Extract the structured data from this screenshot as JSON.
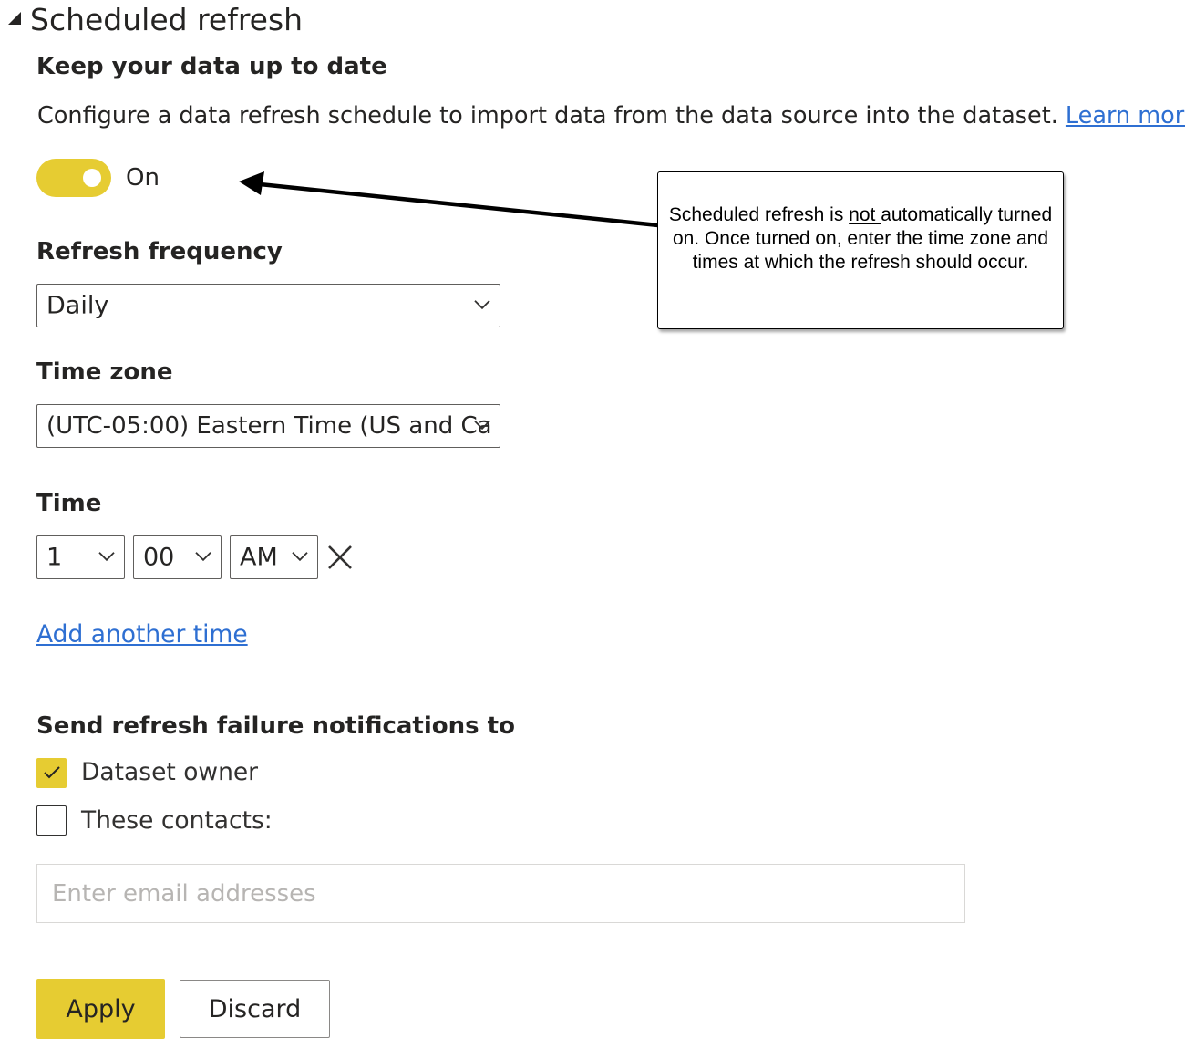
{
  "section": {
    "title": "Scheduled refresh"
  },
  "intro": {
    "heading": "Keep your data up to date",
    "description": "Configure a data refresh schedule to import data from the data source into the dataset.",
    "learn_more": "Learn more"
  },
  "toggle": {
    "state": "on",
    "label": "On"
  },
  "refresh_frequency": {
    "label": "Refresh frequency",
    "value": "Daily"
  },
  "time_zone": {
    "label": "Time zone",
    "value": "(UTC-05:00) Eastern Time (US and Ca"
  },
  "time": {
    "label": "Time",
    "hour": "1",
    "minute": "00",
    "period": "AM",
    "add_another": "Add another time"
  },
  "notifications": {
    "heading": "Send refresh failure notifications to",
    "dataset_owner": {
      "label": "Dataset owner",
      "checked": true
    },
    "contacts": {
      "label": "These contacts:",
      "checked": false
    },
    "email_placeholder": "Enter email addresses",
    "email_value": ""
  },
  "buttons": {
    "apply": "Apply",
    "discard": "Discard"
  },
  "callout": {
    "part1": "Scheduled refresh is ",
    "underlined": "not ",
    "part2": "automatically turned on. Once turned on, enter the time zone and times at which the refresh should occur."
  },
  "colors": {
    "accent": "#e6cc32",
    "link": "#2e6fd2",
    "text": "#252423"
  },
  "icons": {
    "section_toggle": "caret-down-icon",
    "dropdown": "chevron-down-icon",
    "remove_time": "close-icon",
    "checkbox_checked": "checkmark-icon"
  }
}
